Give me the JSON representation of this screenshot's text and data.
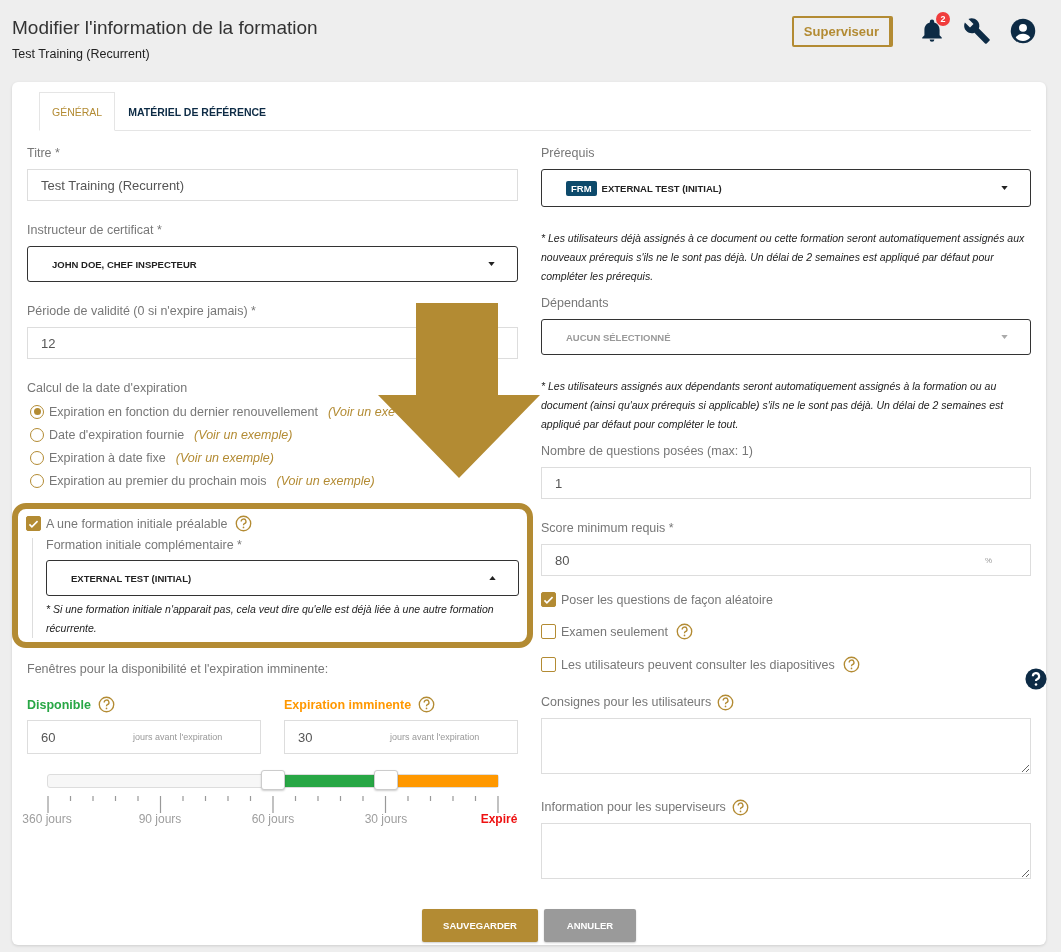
{
  "header": {
    "title": "Modifier l'information de la formation",
    "subtitle": "Test Training (Recurrent)",
    "role_button": "Superviseur",
    "notification_count": "2"
  },
  "tabs": [
    {
      "label": "GÉNÉRAL",
      "selected": true
    },
    {
      "label": "MATÉRIEL DE RÉFÉRENCE",
      "selected": false
    }
  ],
  "title_field": {
    "label": "Titre *",
    "value": "Test Training (Recurrent)"
  },
  "instructor": {
    "label": "Instructeur de certificat *",
    "value": "JOHN DOE, CHEF INSPECTEUR"
  },
  "validity": {
    "label": "Période de validité (0 si n'expire jamais) *",
    "value": "12"
  },
  "expiration_calc": {
    "label": "Calcul de la date d'expiration",
    "options": [
      {
        "label": "Expiration en fonction du dernier renouvellement",
        "link": "(Voir un exe",
        "selected": true
      },
      {
        "label": "Date d'expiration fournie",
        "link": "(Voir un exemple)",
        "selected": false
      },
      {
        "label": "Expiration à date fixe",
        "link": "(Voir un exemple)",
        "selected": false
      },
      {
        "label": "Expiration au premier du prochain mois",
        "link": "(Voir un exemple)",
        "selected": false
      }
    ]
  },
  "initial": {
    "checked": true,
    "label": "A une formation initiale préalable",
    "sub_label": "Formation initiale complémentaire *",
    "value": "EXTERNAL TEST (INITIAL)",
    "note": "* Si une formation initiale n'apparait pas, cela veut dire qu'elle est déjà liée à une autre formation récurrente."
  },
  "windows": {
    "title": "Fenêtres pour la disponibilité et l'expiration imminente:",
    "fields": [
      {
        "label": "Disponible",
        "color": "#28a745",
        "value": "60",
        "unit": "jours avant l'expiration"
      },
      {
        "label": "Expiration imminente",
        "color": "#ff9800",
        "value": "30",
        "unit": "jours avant l'expiration"
      }
    ],
    "handles": [
      {
        "level": 0.5
      },
      {
        "level": 0.75
      }
    ],
    "ticks": [
      {
        "label": "360 jours",
        "color": "#9e9e9e"
      },
      {
        "label": "90 jours",
        "color": "#9e9e9e"
      },
      {
        "label": "60 jours",
        "color": "#9e9e9e"
      },
      {
        "label": "30 jours",
        "color": "#9e9e9e"
      },
      {
        "label": "Expiré",
        "color": "#ee1111"
      }
    ]
  },
  "prerequisites": {
    "label": "Prérequis",
    "tag": "FRM",
    "value": "EXTERNAL TEST (INITIAL)",
    "note": "* Les utilisateurs déjà assignés à ce document ou cette formation seront automatiquement assignés aux nouveaux prérequis s'ils ne le sont pas déjà. Un délai de 2 semaines est appliqué par défaut pour compléter les prérequis."
  },
  "dependents": {
    "label": "Dépendants",
    "placeholder": "AUCUN SÉLECTIONNÉ",
    "note": "* Les utilisateurs assignés aux dépendants seront automatiquement assignés à la formation ou au document (ainsi qu'aux prérequis si applicable) s'ils ne le sont pas déjà. Un délai de 2 semaines est appliqué par défaut pour compléter le tout."
  },
  "questions": {
    "label": "Nombre de questions posées (max: 1)",
    "value": "1"
  },
  "score": {
    "label": "Score minimum requis *",
    "value": "80",
    "unit": "%"
  },
  "options": [
    {
      "label": "Poser les questions de façon aléatoire",
      "checked": true,
      "help": false
    },
    {
      "label": "Examen seulement",
      "checked": false,
      "help": true
    },
    {
      "label": "Les utilisateurs peuvent consulter les diapositives",
      "checked": false,
      "help": true
    }
  ],
  "instructions": {
    "label": "Consignes pour les utilisateurs"
  },
  "supervisor_info": {
    "label": "Information pour les superviseurs"
  },
  "buttons": [
    {
      "label": "SAUVEGARDER",
      "kind": "primary"
    },
    {
      "label": "ANNULER",
      "kind": "secondary"
    }
  ]
}
